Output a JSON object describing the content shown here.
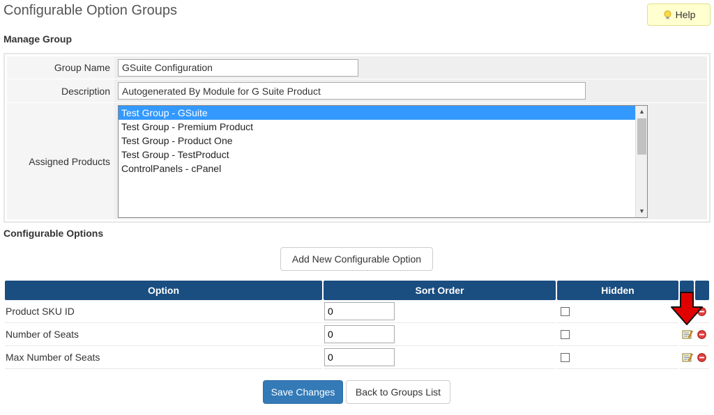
{
  "page": {
    "title": "Configurable Option Groups",
    "help_label": "Help"
  },
  "manage_group": {
    "heading": "Manage Group",
    "group_name_label": "Group Name",
    "group_name_value": "GSuite Configuration",
    "description_label": "Description",
    "description_value": "Autogenerated By Module for G Suite Product",
    "assigned_products_label": "Assigned Products",
    "products": [
      {
        "label": "Test Group - GSuite",
        "selected": true
      },
      {
        "label": "Test Group - Premium Product",
        "selected": false
      },
      {
        "label": "Test Group - Product One",
        "selected": false
      },
      {
        "label": "Test Group - TestProduct",
        "selected": false
      },
      {
        "label": "ControlPanels - cPanel",
        "selected": false
      }
    ]
  },
  "configurable_options": {
    "heading": "Configurable Options",
    "add_button_label": "Add New Configurable Option",
    "columns": {
      "option": "Option",
      "sort_order": "Sort Order",
      "hidden": "Hidden"
    },
    "rows": [
      {
        "option": "Product SKU ID",
        "sort_order": "0",
        "hidden": false
      },
      {
        "option": "Number of Seats",
        "sort_order": "0",
        "hidden": false
      },
      {
        "option": "Max Number of Seats",
        "sort_order": "0",
        "hidden": false
      }
    ]
  },
  "actions": {
    "save_label": "Save Changes",
    "back_label": "Back to Groups List"
  },
  "icons": {
    "help": "lightbulb-icon",
    "edit": "edit-icon",
    "delete": "delete-icon",
    "pointer": "red-arrow-down-icon"
  },
  "colors": {
    "header_bg": "#1a4d80",
    "primary_button": "#337ab7",
    "help_bg": "#ffffd0",
    "selected_option": "#3399ff",
    "arrow": "#e00000"
  }
}
